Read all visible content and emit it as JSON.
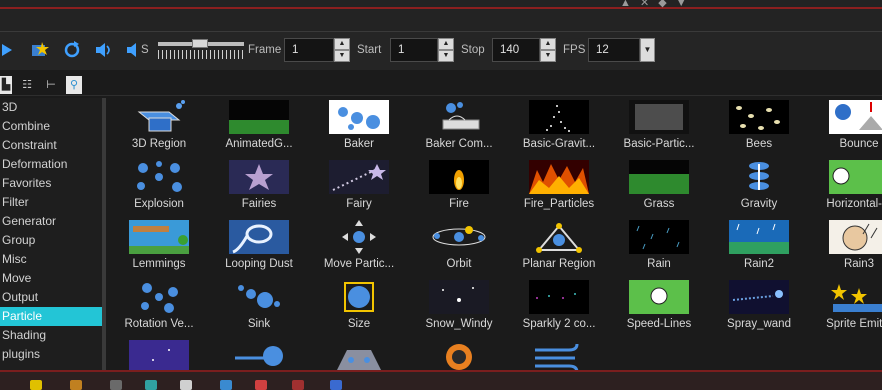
{
  "colors": {
    "accent": "#23c5d6",
    "window_bg": "#1b1b1b",
    "red_line": "#8c1f1f",
    "toolbar_icon_blue": "#3fa0ff"
  },
  "top_glyphs": "▲ ✕ ◆ ▼",
  "toolbar": {
    "icons": [
      "play-icon",
      "star-camera-icon",
      "loop-icon",
      "volume-icon",
      "volume-s-icon"
    ],
    "s_label": "S",
    "frame_label": "Frame",
    "frame_value": "1",
    "start_label": "Start",
    "start_value": "1",
    "stop_label": "Stop",
    "stop_value": "140",
    "fps_label": "FPS",
    "fps_value": "12"
  },
  "view_tabs": [
    "tree-view-icon",
    "list-view-icon",
    "hierarchy-view-icon",
    "search-icon"
  ],
  "sidebar": {
    "items": [
      "3D",
      "Combine",
      "Constraint",
      "Deformation",
      "Favorites",
      "Filter",
      "Generator",
      "Group",
      "Misc",
      "Move",
      "Output",
      "Particle",
      "Shading",
      "plugins"
    ],
    "selected": "Particle"
  },
  "grid": {
    "items": [
      {
        "label": "3D Region"
      },
      {
        "label": "AnimatedG..."
      },
      {
        "label": "Baker"
      },
      {
        "label": "Baker Com..."
      },
      {
        "label": "Basic-Gravit..."
      },
      {
        "label": "Basic-Partic..."
      },
      {
        "label": "Bees"
      },
      {
        "label": "Bounce"
      },
      {
        "label": "Explosion"
      },
      {
        "label": "Fairies"
      },
      {
        "label": "Fairy"
      },
      {
        "label": "Fire"
      },
      {
        "label": "Fire_Particles"
      },
      {
        "label": "Grass"
      },
      {
        "label": "Gravity"
      },
      {
        "label": "Horizontal-..."
      },
      {
        "label": "Lemmings"
      },
      {
        "label": "Looping Dust"
      },
      {
        "label": "Move Partic..."
      },
      {
        "label": "Orbit"
      },
      {
        "label": "Planar Region"
      },
      {
        "label": "Rain"
      },
      {
        "label": "Rain2"
      },
      {
        "label": "Rain3"
      },
      {
        "label": "Rotation Ve..."
      },
      {
        "label": "Sink"
      },
      {
        "label": "Size"
      },
      {
        "label": "Snow_Windy"
      },
      {
        "label": "Sparkly 2 co..."
      },
      {
        "label": "Speed-Lines"
      },
      {
        "label": "Spray_wand"
      },
      {
        "label": "Sprite Emit..."
      },
      {
        "label": ""
      },
      {
        "label": ""
      },
      {
        "label": ""
      },
      {
        "label": ""
      },
      {
        "label": ""
      }
    ]
  }
}
